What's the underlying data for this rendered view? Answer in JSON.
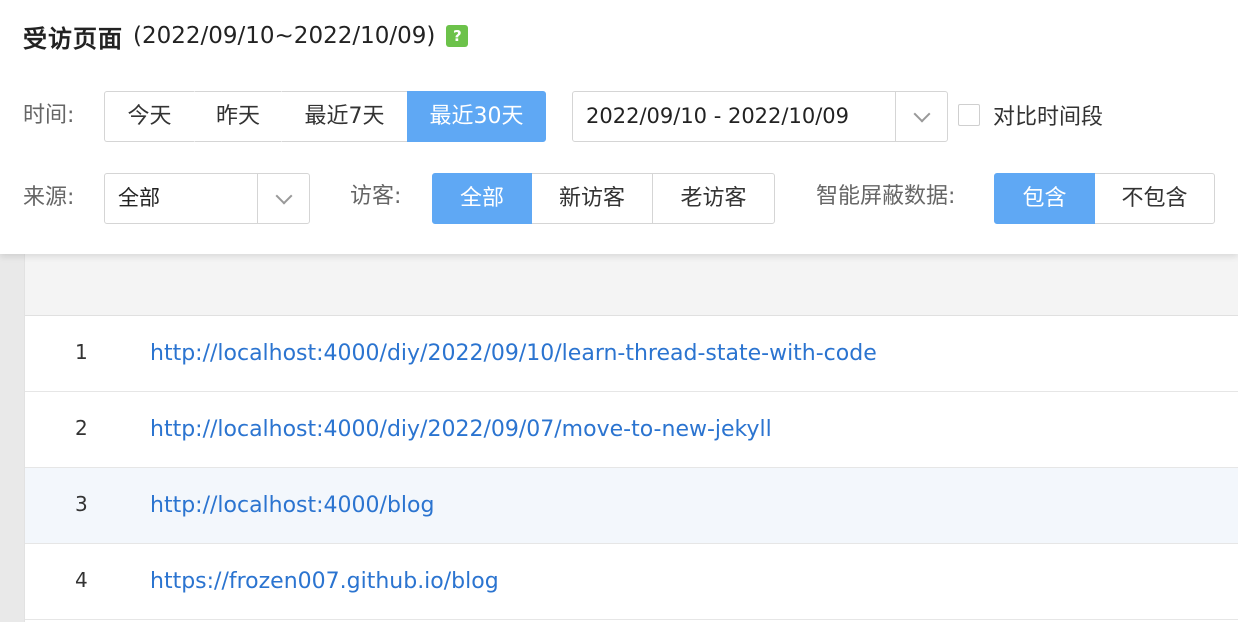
{
  "header": {
    "title": "受访页面",
    "range": "(2022/09/10~2022/10/09)",
    "help_glyph": "?"
  },
  "filters": {
    "time_label": "时间:",
    "time_options": [
      "今天",
      "昨天",
      "最近7天",
      "最近30天"
    ],
    "time_selected": "最近30天",
    "date_range_value": "2022/09/10 - 2022/10/09",
    "compare_label": "对比时间段",
    "compare_checked": false,
    "source_label": "来源:",
    "source_value": "全部",
    "visitor_label": "访客:",
    "visitor_options": [
      "全部",
      "新访客",
      "老访客"
    ],
    "visitor_selected": "全部",
    "smart_label": "智能屏蔽数据:",
    "smart_options": [
      "包含",
      "不包含"
    ],
    "smart_selected": "包含"
  },
  "table": {
    "rows": [
      {
        "index": "1",
        "url": "http://localhost:4000/diy/2022/09/10/learn-thread-state-with-code",
        "highlight": false
      },
      {
        "index": "2",
        "url": "http://localhost:4000/diy/2022/09/07/move-to-new-jekyll",
        "highlight": false
      },
      {
        "index": "3",
        "url": "http://localhost:4000/blog",
        "highlight": true
      },
      {
        "index": "4",
        "url": "https://frozen007.github.io/blog",
        "highlight": false
      }
    ]
  },
  "colors": {
    "accent": "#5fa8f4",
    "link": "#2b74d0",
    "help_icon": "#6cc24a",
    "row_highlight": "#f3f7fc"
  },
  "icons": {
    "help": "question-icon",
    "dropdown": "chevron-down-icon"
  }
}
